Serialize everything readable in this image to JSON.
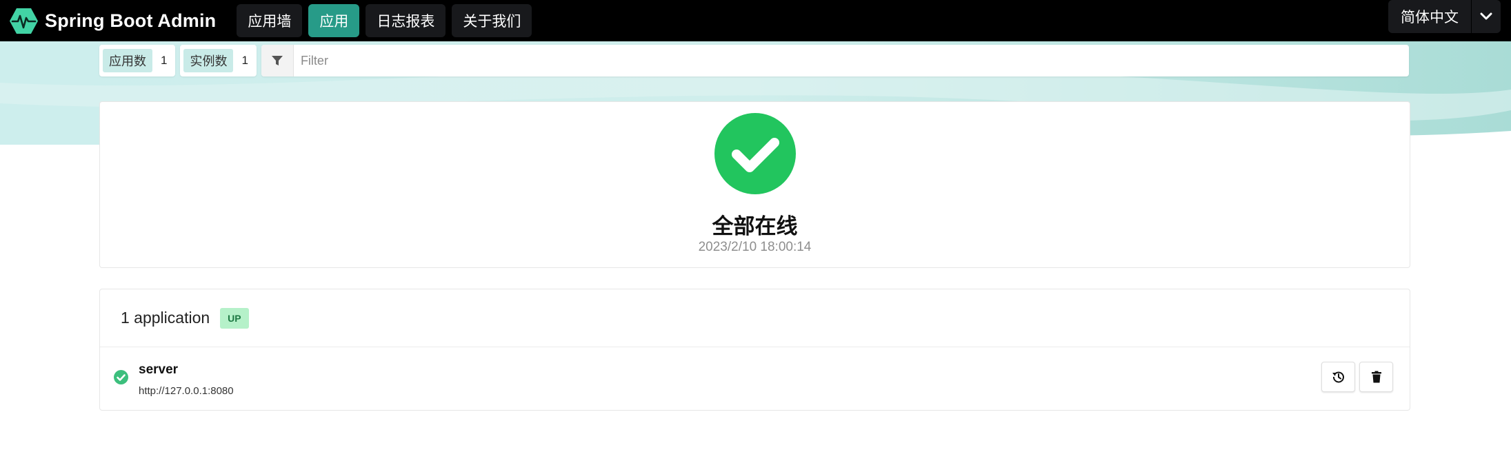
{
  "brand": {
    "name": "Spring Boot Admin",
    "icon": "heartbeat-hexagon-icon",
    "logo_color": "#42d3a5"
  },
  "nav": {
    "items": [
      {
        "label": "应用墙",
        "active": false
      },
      {
        "label": "应用",
        "active": true
      },
      {
        "label": "日志报表",
        "active": false
      },
      {
        "label": "关于我们",
        "active": false
      }
    ],
    "language": {
      "label": "简体中文",
      "icon": "chevron-down-icon"
    }
  },
  "filter_bar": {
    "applications_label": "应用数",
    "applications_count": "1",
    "instances_label": "实例数",
    "instances_count": "1",
    "filter_icon": "funnel-icon",
    "filter_placeholder": "Filter",
    "filter_value": ""
  },
  "status": {
    "icon": "check-circle-icon",
    "title": "全部在线",
    "timestamp": "2023/2/10 18:00:14",
    "color": "#22c55e"
  },
  "applications": {
    "count_label": "1 application",
    "status_badge": "UP",
    "items": [
      {
        "name": "server",
        "url": "http://127.0.0.1:8080",
        "status_icon": "check-circle-icon",
        "actions": [
          "history-icon",
          "trash-icon"
        ]
      }
    ]
  },
  "colors": {
    "accent": "#279b88",
    "navbar": "#000000",
    "up_badge_bg": "#b5f1c9",
    "up_badge_text": "#1d7a43"
  }
}
